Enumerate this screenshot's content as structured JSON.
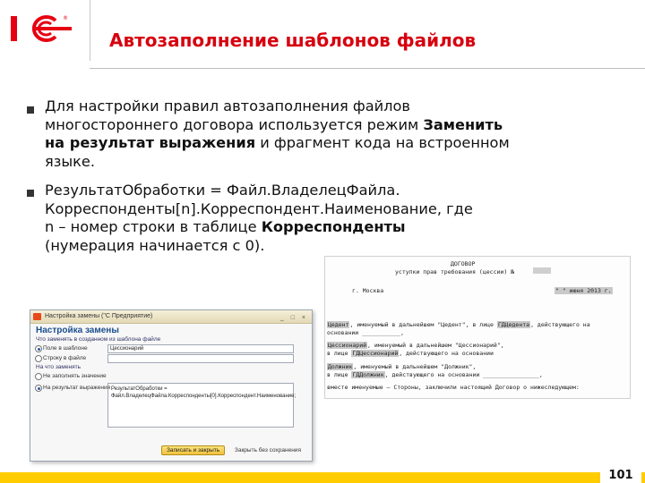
{
  "header": {
    "title": "Автозаполнение шаблонов файлов"
  },
  "bullets": {
    "first_part1": "Для настройки правил автозаполнения файлов многостороннего договора используется режим ",
    "first_bold": "Заменить на результат выражения",
    "first_part2": " и фрагмент кода на встроенном языке.",
    "second_part1": "РезультатОбработки = Файл.ВладелецФайла. Корреспонденты[n].Корреспондент.Наименование, где n – номер строки в таблице ",
    "second_bold": "Корреспонденты",
    "second_part2": " (нумерация начинается с 0)."
  },
  "dialog": {
    "window_title": "Настройка замены  (\"С Предприятие)",
    "window_buttons": "_ □ ×",
    "heading": "Настройка замены",
    "what_label": "Что заменять в созданном из шаблона файле",
    "opt_field": "Поле в шаблоне",
    "field_value": "Цессионарий",
    "opt_string": "Строку в файле",
    "replace_label": "На что заменять",
    "opt_not_fill": "Не заполнять значение",
    "opt_result": "На результат выражения",
    "expression_line1": "РезультатОбработки =",
    "expression_line2": "Файл.ВладелецФайла.Корреспонденты[0].Корреспондент.Наименование;",
    "save_button": "Записать и закрыть",
    "close_button": "Закрыть без сохранения"
  },
  "document": {
    "heading": "ДОГОВОР",
    "subheading": "уступки прав требования (цессии) №",
    "city": "г. Москва",
    "date": "\"  \" июня 2013 г.",
    "line1_hl": "Цедент",
    "line1_rest": ", именуемый в дальнейшем \"Цедент\", в лице ",
    "line1_hl2": "ГДЦедента",
    "line1_end": ", действующего на",
    "line2": "основании ___________,",
    "line3_hl": "Цессионарий",
    "line3_rest": ", именуемый в дальнейшем \"Цессионарий\",",
    "line4_pre": "в лице ",
    "line4_hl": "ГДЦессионарий",
    "line4_rest": ", действующего на основании",
    "line5_hl": "Должник",
    "line5_rest": ", именуемый в дальнейшем \"Должник\",",
    "line6_pre": "в лице ",
    "line6_hl": "ГДДолжник",
    "line6_rest": ", действующего на основании ________________,",
    "line7": "вместе именуемые – Стороны, заключили настоящий Договор о нижеследующем:"
  },
  "footer": {
    "page_number": "101"
  },
  "colors": {
    "title": "#d7000f",
    "logo": "#e60012",
    "footer_bar": "#ffcc00"
  }
}
